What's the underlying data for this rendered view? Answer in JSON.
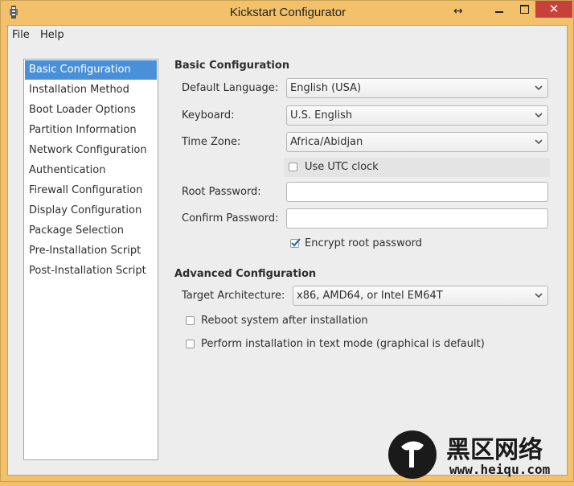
{
  "window": {
    "title": "Kickstart Configurator"
  },
  "menu": {
    "file": "File",
    "help": "Help"
  },
  "sidebar": {
    "items": [
      {
        "label": "Basic Configuration",
        "selected": true
      },
      {
        "label": "Installation Method"
      },
      {
        "label": "Boot Loader Options"
      },
      {
        "label": "Partition Information"
      },
      {
        "label": "Network Configuration"
      },
      {
        "label": "Authentication"
      },
      {
        "label": "Firewall Configuration"
      },
      {
        "label": "Display Configuration"
      },
      {
        "label": "Package Selection"
      },
      {
        "label": "Pre-Installation Script"
      },
      {
        "label": "Post-Installation Script"
      }
    ]
  },
  "basic": {
    "title": "Basic Configuration",
    "language_label": "Default Language:",
    "language_value": "English (USA)",
    "keyboard_label": "Keyboard:",
    "keyboard_value": "U.S. English",
    "timezone_label": "Time Zone:",
    "timezone_value": "Africa/Abidjan",
    "utc_label": "Use UTC clock",
    "utc_checked": false,
    "root_password_label": "Root Password:",
    "root_password_value": "",
    "confirm_password_label": "Confirm Password:",
    "confirm_password_value": "",
    "encrypt_label": "Encrypt root password",
    "encrypt_checked": true
  },
  "advanced": {
    "title": "Advanced Configuration",
    "arch_label": "Target Architecture:",
    "arch_value": "x86, AMD64, or Intel EM64T",
    "reboot_label": "Reboot system after installation",
    "reboot_checked": false,
    "textmode_label": "Perform installation in text mode (graphical is default)",
    "textmode_checked": false
  },
  "watermark": {
    "cn": "黑区网络",
    "url": "www.heiqu.com"
  },
  "colors": {
    "titlebar": "#f2c16a",
    "selection": "#4a90d9",
    "close": "#c7403a"
  },
  "icons": [
    "app-icon",
    "resize-icon",
    "minimize-icon",
    "maximize-icon",
    "close-icon",
    "chevron-down-icon",
    "checkmark-icon"
  ]
}
